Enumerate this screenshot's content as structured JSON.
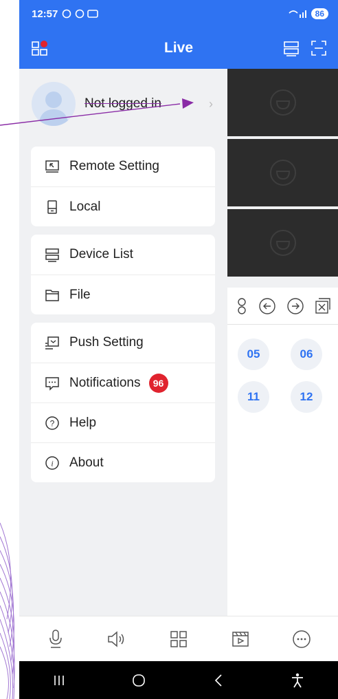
{
  "status_bar": {
    "time": "12:57",
    "battery": "86"
  },
  "app_bar": {
    "title": "Live"
  },
  "profile": {
    "name": "Not logged in"
  },
  "menu": {
    "group1": [
      {
        "label": "Remote Setting",
        "icon": "remote-setting-icon"
      },
      {
        "label": "Local",
        "icon": "local-icon"
      }
    ],
    "group2": [
      {
        "label": "Device List",
        "icon": "device-list-icon"
      },
      {
        "label": "File",
        "icon": "file-icon"
      }
    ],
    "group3": [
      {
        "label": "Push Setting",
        "icon": "push-setting-icon"
      },
      {
        "label": "Notifications",
        "icon": "notifications-icon",
        "badge": "96"
      },
      {
        "label": "Help",
        "icon": "help-icon"
      },
      {
        "label": "About",
        "icon": "about-icon"
      }
    ]
  },
  "channels": [
    "05",
    "06",
    "11",
    "12"
  ],
  "toolbar": [
    "microphone-icon",
    "speaker-icon",
    "grid-layout-icon",
    "playback-icon",
    "more-icon"
  ],
  "colors": {
    "accent": "#2f73f2",
    "badge": "#e0232e",
    "annotation": "#8a2ca6"
  }
}
